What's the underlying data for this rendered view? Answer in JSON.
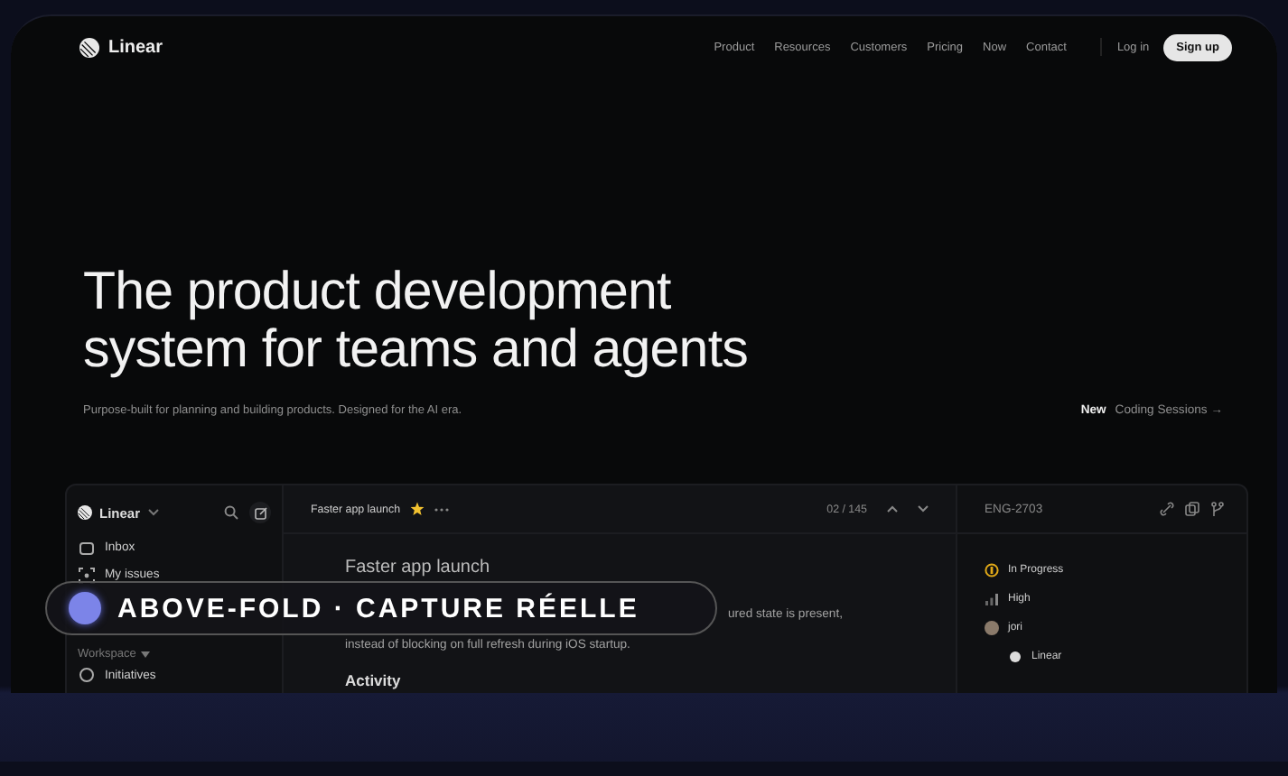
{
  "nav": {
    "brand": "Linear",
    "links": [
      "Product",
      "Resources",
      "Customers",
      "Pricing",
      "Now",
      "Contact"
    ],
    "login": "Log in",
    "signup": "Sign up"
  },
  "hero": {
    "title_lines": [
      "The product development",
      "system for teams and agents"
    ],
    "subtitle": "Purpose-built for planning and building products. Designed for the AI era.",
    "news_tag": "New",
    "news_link": "Coding Sessions →"
  },
  "app": {
    "workspace": "Linear",
    "sidebar_items": [
      {
        "label": "Inbox",
        "kind": "inbox"
      },
      {
        "label": "My issues",
        "kind": "issues"
      }
    ],
    "section": {
      "label": "Workspace",
      "expanded": true
    },
    "section_items": [
      {
        "label": "Initiatives",
        "kind": "initiatives"
      }
    ],
    "issue_breadcrumb": "Faster app launch",
    "starred": true,
    "counter": "02 / 145",
    "issue_title": "Faster app launch",
    "description_lines": [
      "ured state is present,",
      "instead of blocking on full refresh during iOS startup."
    ],
    "activity_heading": "Activity",
    "issue_id": "ENG-2703",
    "properties": [
      {
        "label": "In Progress",
        "kind": "status"
      },
      {
        "label": "High",
        "kind": "priority"
      },
      {
        "label": "jori",
        "kind": "assignee"
      },
      {
        "label": "Linear",
        "kind": "team"
      }
    ]
  },
  "overlay_badge": {
    "label": "ABOVE-FOLD · CAPTURE RÉELLE"
  }
}
